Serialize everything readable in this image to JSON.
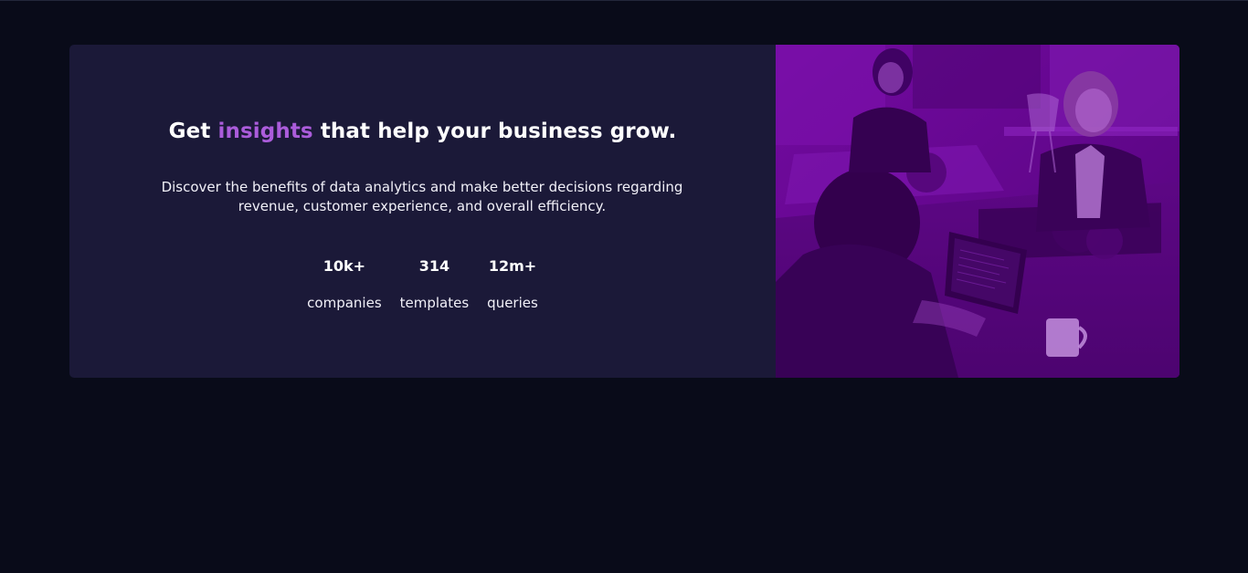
{
  "hero": {
    "headline_prefix": "Get",
    "headline_accent": "insights",
    "headline_suffix": "that help your business grow.",
    "description": "Discover the benefits of data analytics and make better decisions regarding revenue, customer experience, and overall efficiency.",
    "stats": [
      {
        "value": "10k+",
        "label": "companies"
      },
      {
        "value": "314",
        "label": "templates"
      },
      {
        "value": "12m+",
        "label": "queries"
      }
    ]
  },
  "colors": {
    "background": "#090b19",
    "card": "#1b1938",
    "accent": "#ab5cdb",
    "image_tint": "#8a00d4"
  },
  "image": {
    "icon": "office-team-photo"
  }
}
